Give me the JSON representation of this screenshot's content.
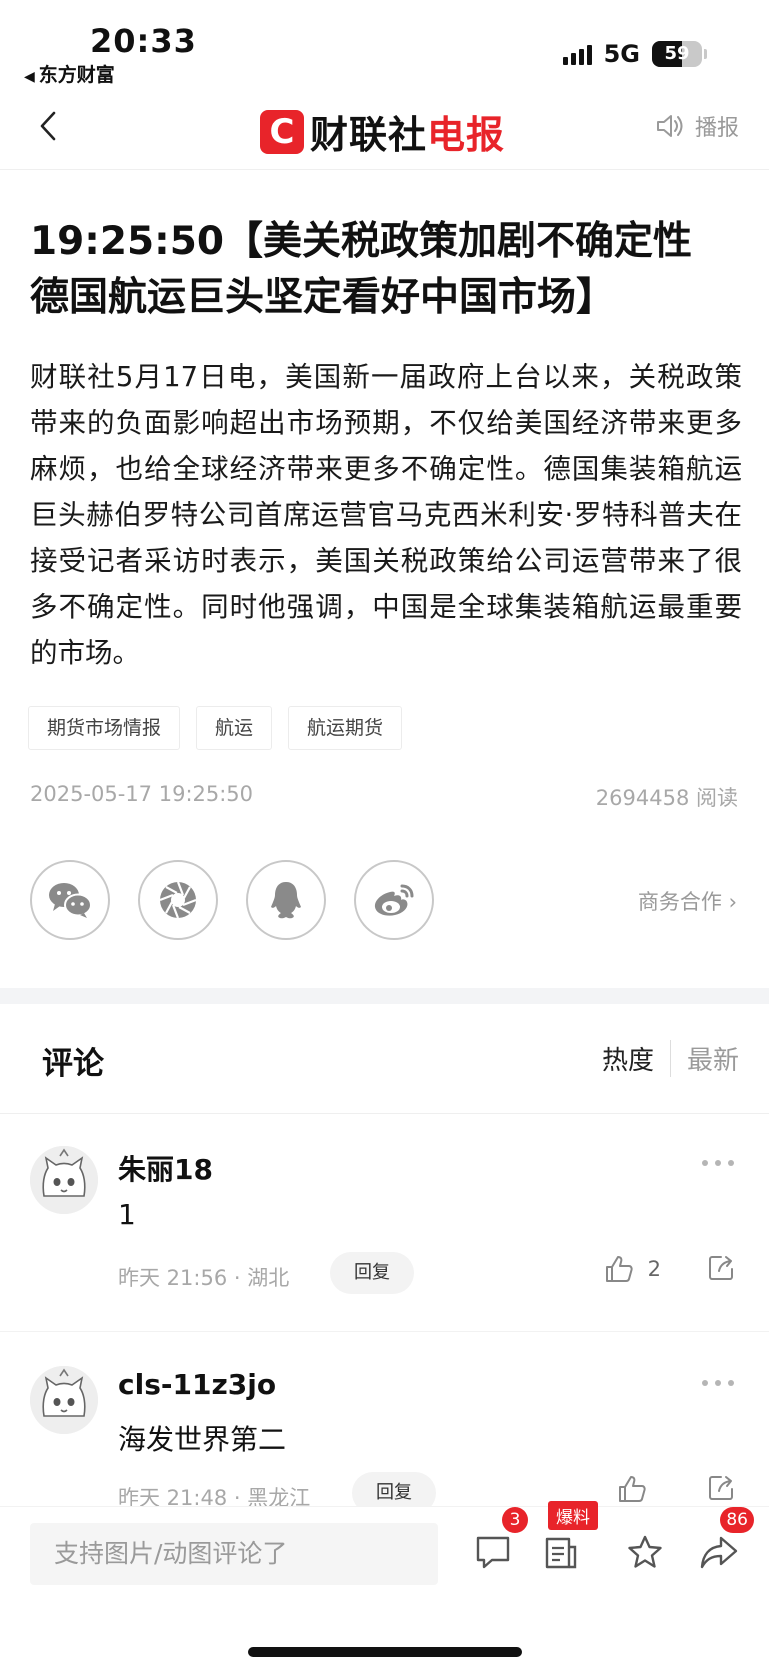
{
  "status_bar": {
    "time": "20:33",
    "back_app": "东方财富",
    "network": "5G",
    "battery": "59"
  },
  "nav": {
    "logo_mark": "C",
    "logo_text_main": "财联社",
    "logo_text_accent": "电报",
    "broadcast_label": "播报"
  },
  "article": {
    "headline": "19:25:50【美关税政策加剧不确定性 德国航运巨头坚定看好中国市场】",
    "body": "财联社5月17日电，美国新一届政府上台以来，关税政策带来的负面影响超出市场预期，不仅给美国经济带来更多麻烦，也给全球经济带来更多不确定性。德国集装箱航运巨头赫伯罗特公司首席运营官马克西米利安·罗特科普夫在接受记者采访时表示，美国关税政策给公司运营带来了很多不确定性。同时他强调，中国是全球集装箱航运最重要的市场。",
    "tags": [
      "期货市场情报",
      "航运",
      "航运期货"
    ],
    "datetime": "2025-05-17 19:25:50",
    "read_count": "2694458 阅读",
    "share_icons": [
      "wechat-icon",
      "moments-icon",
      "qq-icon",
      "weibo-icon"
    ],
    "business_link": "商务合作 ›"
  },
  "comments": {
    "title": "评论",
    "sort_hot": "热度",
    "sort_new": "最新",
    "items": [
      {
        "user": "朱丽18",
        "text": "1",
        "time": "昨天 21:56 · 湖北",
        "reply_label": "回复",
        "likes": "2"
      },
      {
        "user": "cls-11z3jo",
        "text": "海发世界第二",
        "time": "昨天 21:48 · 黑龙江",
        "reply_label": "回复",
        "likes": ""
      }
    ]
  },
  "bottom_bar": {
    "input_placeholder": "支持图片/动图评论了",
    "comment_badge": "3",
    "tip_label": "爆料",
    "share_badge": "86"
  },
  "colors": {
    "brand_red": "#e8242a",
    "muted_text": "#a8a8a8"
  }
}
